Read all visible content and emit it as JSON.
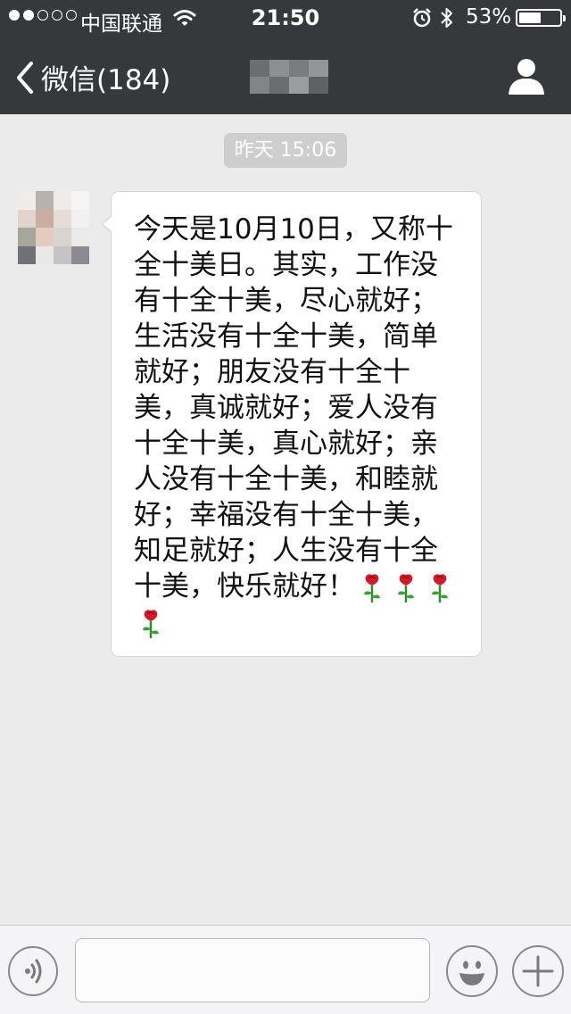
{
  "status_bar": {
    "carrier": "中国联通",
    "time": "21:50",
    "battery_percent": "53%",
    "battery_level": 0.53,
    "signal_strength": 2,
    "icons": [
      "signal-dots-icon",
      "wifi-icon",
      "alarm-icon",
      "bluetooth-icon",
      "battery-icon"
    ]
  },
  "nav": {
    "back_label": "微信(184)",
    "back_icon": "chevron-left-icon",
    "contact_icon": "person-icon"
  },
  "chat": {
    "timestamp": "昨天 15:06",
    "messages": [
      {
        "sender": "other",
        "text": "今天是10月10日，又称十全十美日。其实，工作没有十全十美，尽心就好；生活没有十全十美，简单就好；朋友没有十全十美，真诚就好；爱人没有十全十美，真心就好；亲人没有十全十美，和睦就好；幸福没有十全十美，知足就好；人生没有十全十美，快乐就好！",
        "emoji": [
          "rose",
          "rose",
          "rose",
          "rose"
        ]
      }
    ]
  },
  "input_bar": {
    "input_value": "",
    "icons": [
      "voice-icon",
      "smiley-icon",
      "plus-icon"
    ]
  },
  "colors": {
    "nav_bg": "#36383b",
    "chat_bg": "#ebebeb",
    "bubble_bg": "#ffffff",
    "timestamp_bg": "#cecece"
  }
}
